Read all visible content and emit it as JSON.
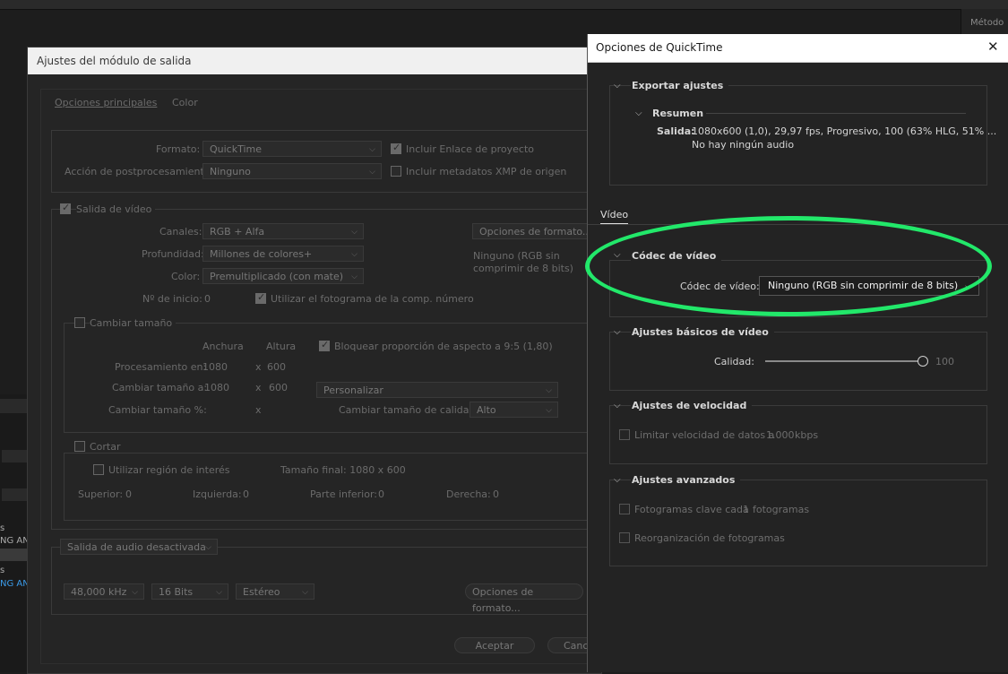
{
  "bg": {
    "right_panel_label": "Método",
    "left_texts": [
      "s",
      "NG ANI",
      "s",
      "NG ANI"
    ]
  },
  "output_module": {
    "title": "Ajustes del módulo de salida",
    "tabs": [
      "Opciones principales",
      "Color"
    ],
    "format_label": "Formato:",
    "format_value": "QuickTime",
    "post_label": "Acción de postprocesamiento:",
    "post_value": "Ninguno",
    "include_link": "Incluir Enlace de proyecto",
    "include_xmp": "Incluir metadatos XMP de origen",
    "video_output": "Salida de vídeo",
    "channels_label": "Canales:",
    "channels_value": "RGB + Alfa",
    "depth_label": "Profundidad:",
    "depth_value": "Millones de colores+",
    "color_label": "Color:",
    "color_value": "Premultiplicado (con mate)",
    "start_label": "Nº de inicio:",
    "start_value": "0",
    "use_frame": "Utilizar el fotograma de la comp. número",
    "format_options": "Opciones de formato...",
    "format_note": "Ninguno (RGB sin comprimir de 8 bits)",
    "resize": "Cambiar tamaño",
    "width_h": "Anchura",
    "height_h": "Altura",
    "lock_aspect": "Bloquear proporción de aspecto a 9:5 (1,80)",
    "rendering_label": "Procesamiento en:",
    "rendering_w": "1080",
    "rendering_h": "600",
    "resize_to_label": "Cambiar tamaño a:",
    "resize_to_w": "1080",
    "resize_to_h": "600",
    "custom": "Personalizar",
    "resize_pct_label": "Cambiar tamaño %:",
    "quality_label": "Cambiar tamaño de calidad:",
    "quality_value": "Alto",
    "crop": "Cortar",
    "roi": "Utilizar región de interés",
    "final_size": "Tamaño final: 1080 x 600",
    "top_label": "Superior:",
    "top_v": "0",
    "left_label": "Izquierda:",
    "left_v": "0",
    "bottom_label": "Parte inferior:",
    "bottom_v": "0",
    "right_label": "Derecha:",
    "right_v": "0",
    "audio_out": "Salida de audio desactivada",
    "audio_rate": "48,000 kHz",
    "audio_bits": "16 Bits",
    "audio_ch": "Estéreo",
    "audio_fmt_opts": "Opciones de formato...",
    "ok": "Aceptar",
    "cancel": "Canc"
  },
  "quicktime": {
    "title": "Opciones de QuickTime",
    "close_icon": "close-icon",
    "export_settings": "Exportar ajustes",
    "summary": "Resumen",
    "output_label": "Salida:",
    "output_line1": "1080x600 (1,0), 29,97 fps, Progresivo, 100 (63% HLG, 51% ...",
    "output_line2": "No hay ningún audio",
    "tab_video": "Vídeo",
    "codec_section": "Códec de vídeo",
    "codec_label": "Códec de vídeo:",
    "codec_value": "Ninguno (RGB sin comprimir de 8 bits)",
    "basic_section": "Ajustes básicos de vídeo",
    "quality_label": "Calidad:",
    "quality_value": "100",
    "bitrate_section": "Ajustes de velocidad",
    "limit_rate": "Limitar velocidad de datos a",
    "rate_value": "1.000",
    "rate_unit": "kbps",
    "advanced_section": "Ajustes avanzados",
    "keyframes": "Fotogramas clave cada",
    "keyframes_value": "1",
    "keyframes_unit": "fotogramas",
    "reorder": "Reorganización de fotogramas",
    "annotation_color": "#22e86a"
  }
}
